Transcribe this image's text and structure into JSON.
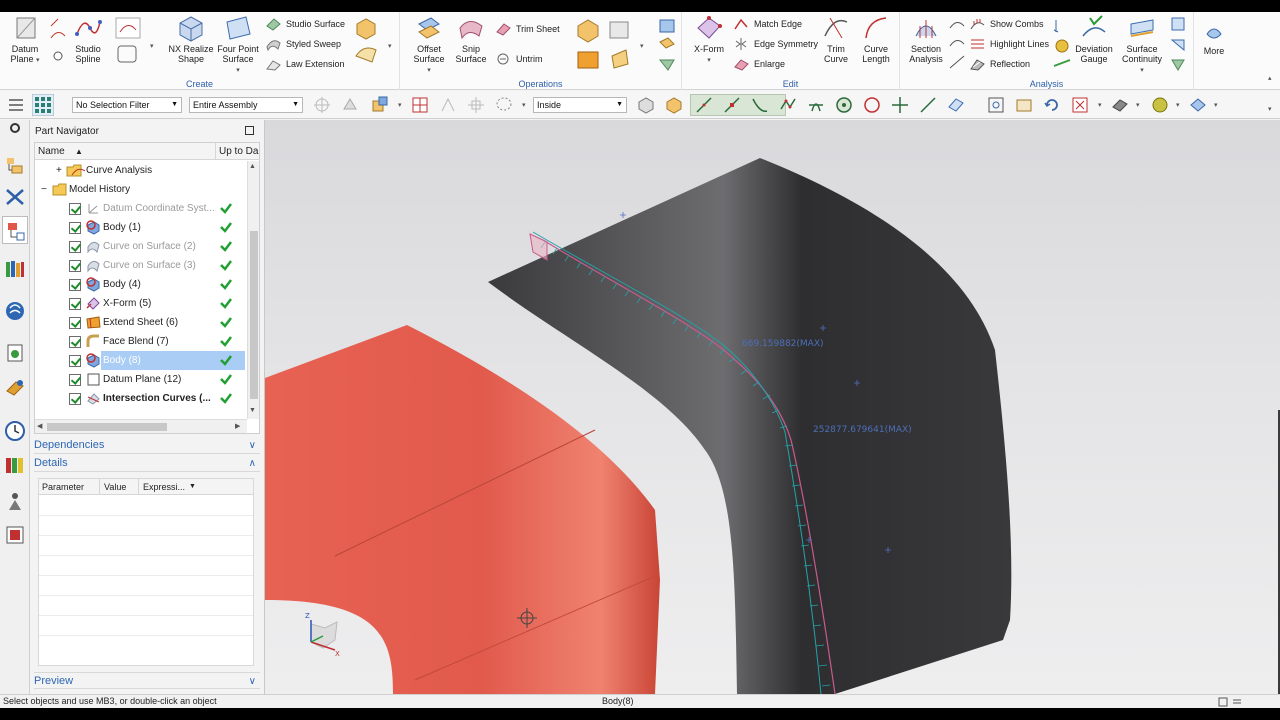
{
  "ribbon": {
    "create": {
      "label": "Create",
      "datum_plane": "Datum Plane",
      "studio_spline": "Studio Spline",
      "nx_realize_shape": "NX Realize Shape",
      "four_point_surface": "Four Point Surface",
      "studio_surface": "Studio Surface",
      "styled_sweep": "Styled Sweep",
      "law_extension": "Law Extension"
    },
    "operations": {
      "label": "Operations",
      "offset_surface": "Offset Surface",
      "snip_surface": "Snip Surface",
      "trim_sheet": "Trim Sheet",
      "untrim": "Untrim"
    },
    "edit": {
      "label": "Edit",
      "x_form": "X-Form",
      "match_edge": "Match Edge",
      "edge_symmetry": "Edge Symmetry",
      "enlarge": "Enlarge",
      "trim_curve": "Trim Curve",
      "curve_length": "Curve Length"
    },
    "analysis": {
      "label": "Analysis",
      "section_analysis": "Section Analysis",
      "show_combs": "Show Combs",
      "highlight_lines": "Highlight Lines",
      "reflection": "Reflection",
      "deviation_gauge": "Deviation Gauge",
      "surface_continuity": "Surface Continuity"
    },
    "more": "More"
  },
  "selection_bar": {
    "filter": "No Selection Filter",
    "scope": "Entire Assembly",
    "mode": "Inside"
  },
  "navigator": {
    "title": "Part Navigator",
    "col_name": "Name",
    "col_uptodate": "Up to Da",
    "items": [
      {
        "label": "Curve Analysis"
      },
      {
        "label": "Model History"
      },
      {
        "label": "Datum Coordinate Syst..."
      },
      {
        "label": "Body (1)"
      },
      {
        "label": "Curve on Surface (2)"
      },
      {
        "label": "Curve on Surface (3)"
      },
      {
        "label": "Body (4)"
      },
      {
        "label": "X-Form (5)"
      },
      {
        "label": "Extend Sheet (6)"
      },
      {
        "label": "Face Blend (7)"
      },
      {
        "label": "Body (8)"
      },
      {
        "label": "Datum Plane (12)"
      },
      {
        "label": "Intersection Curves (..."
      }
    ],
    "dependencies": "Dependencies",
    "details": "Details",
    "details_cols": [
      "Parameter",
      "Value",
      "Expressi..."
    ],
    "preview": "Preview"
  },
  "viewport": {
    "label_max1": "669.159882(MAX)",
    "label_max2": "252877.679641(MAX)",
    "triad_z": "Z",
    "triad_x": "X"
  },
  "status": {
    "prompt": "Select objects and use MB3, or double-click an object",
    "selection": "Body(8)"
  },
  "colors": {
    "accent": "#2d67b4",
    "red_surface": "#e0574a",
    "dark_surface": "#2f2f31",
    "comb": "#23a3a8"
  }
}
